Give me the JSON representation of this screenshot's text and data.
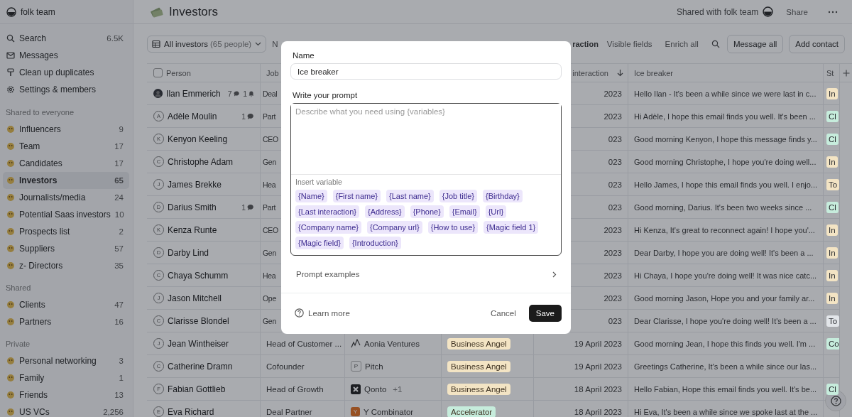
{
  "workspace": {
    "name": "folk team"
  },
  "nav": [
    {
      "label": "Search",
      "count": "6.5K"
    },
    {
      "label": "Messages"
    },
    {
      "label": "Clean up duplicates"
    },
    {
      "label": "Settings & members"
    }
  ],
  "sections": [
    {
      "title": "Shared to everyone",
      "items": [
        {
          "label": "Influencers",
          "count": "9",
          "selected": false
        },
        {
          "label": "Team",
          "count": "17",
          "selected": false
        },
        {
          "label": "Candidates",
          "count": "17",
          "selected": false
        },
        {
          "label": "Investors",
          "count": "65",
          "selected": true
        },
        {
          "label": "Journalists/media",
          "count": "24",
          "selected": false
        },
        {
          "label": "Potential Saas investors",
          "count": "10",
          "selected": false
        },
        {
          "label": "Prospects list",
          "count": "2",
          "selected": false
        },
        {
          "label": "Suppliers",
          "count": "57",
          "selected": false
        },
        {
          "label": "z- Directors",
          "count": "35",
          "selected": false
        }
      ]
    },
    {
      "title": "Shared",
      "items": [
        {
          "label": "Clients",
          "count": "47",
          "selected": false
        },
        {
          "label": "Partners",
          "count": "16",
          "selected": false
        }
      ]
    },
    {
      "title": "Private",
      "items": [
        {
          "label": "Personal networking",
          "count": "3",
          "selected": false
        },
        {
          "label": "Family",
          "count": "1",
          "selected": false
        },
        {
          "label": "Friends",
          "count": "13",
          "selected": false
        },
        {
          "label": "US VCs",
          "count": "2,256",
          "selected": false
        }
      ]
    }
  ],
  "page": {
    "title": "Investors",
    "shared_with": "Shared with folk team",
    "share": "Share"
  },
  "toolbar": {
    "view": "All investors",
    "view_count": "(65 people)",
    "cut_button": "N",
    "sort": "raction",
    "actions": [
      "Visible fields",
      "Enrich all"
    ],
    "buttons": [
      "Message all",
      "Add contact"
    ]
  },
  "table": {
    "header": {
      "checked": false,
      "person": "Person",
      "job": "Job",
      "date": "interaction",
      "ice_breaker": "Ice breaker",
      "status": "St"
    },
    "rows": [
      {
        "name": "Ilan Emmerich",
        "comments": "7",
        "reminders": "1",
        "job": "Deal",
        "date": "2023",
        "ice_breaker": "Hello Ilan - It's been a while since we were last in c...",
        "status": {
          "label": "In",
          "color": "#f3e4c4"
        }
      },
      {
        "name": "Adèle Moulin",
        "initial": "A",
        "comments": "1",
        "job": "Part",
        "date": "2023",
        "ice_breaker": "Hi Adèle, I hope this email finds you well. It's been ...",
        "status": {
          "label": "Cl",
          "color": "#c6ecdc"
        }
      },
      {
        "name": "Kenyon Keeling",
        "initial": "K",
        "job": "CEO",
        "date": "023",
        "ice_breaker": "Good morning Kenyon, I hope this message finds y...",
        "status": {
          "label": "Cl",
          "color": "#c6ecdc"
        }
      },
      {
        "name": "Christophe Adam",
        "initial": "C",
        "job": "Gen",
        "date": "023",
        "ice_breaker": "Good morning Christophe, I hope you're doing well...",
        "status": {
          "label": "In",
          "color": "#f3e4c4"
        }
      },
      {
        "name": "James Brekke",
        "initial": "J",
        "job": "Hea",
        "date": "023",
        "ice_breaker": "Hello James, I hope this email finds you well. I enjo...",
        "status": {
          "label": "To",
          "color": "#f3e4c4"
        }
      },
      {
        "name": "Darius Smith",
        "initial": "D",
        "comments": "1",
        "job": "Part",
        "date": "023",
        "ice_breaker": "Good morning, Darius. It's been two weeks since ...",
        "status": {
          "label": "Cl",
          "color": "#c6ecdc"
        }
      },
      {
        "name": "Kenza Runte",
        "initial": "K",
        "job": "CEO",
        "date": "2023",
        "ice_breaker": "Hi Kenza, It's great to reconnect again! I hope you'...",
        "status": {
          "label": "In",
          "color": "#f3e4c4"
        }
      },
      {
        "name": "Darby Lind",
        "initial": "D",
        "job": "Gen",
        "date": "2023",
        "ice_breaker": "Dear Darby, I hope you are doing well! It's been a ...",
        "status": {
          "label": "In",
          "color": "#f3e4c4"
        }
      },
      {
        "name": "Chaya Schumm",
        "initial": "C",
        "job": "Hea",
        "date": "2023",
        "ice_breaker": "Hi Chaya, I hope you're doing well! It was nice catc...",
        "status": {
          "label": "In",
          "color": "#f3e4c4"
        }
      },
      {
        "name": "Jason Mitchell",
        "initial": "J",
        "job": "Ope",
        "date": "2023",
        "ice_breaker": "Good morning Jason, Hope you and your family ar...",
        "status": {
          "label": "In",
          "color": "#f3e4c4"
        }
      },
      {
        "name": "Clarisse Blondel",
        "initial": "C",
        "job": "Gen",
        "date": "023",
        "ice_breaker": "Dear Clarisse, I hope you're doing well! It's been a ...",
        "status": {
          "label": "To",
          "color": "#e2e5e9"
        }
      },
      {
        "name": "Jean Wintheiser",
        "initial": "J",
        "job": "Head of Customer ...",
        "company": {
          "name": "Aonia Ventures",
          "kind": "line"
        },
        "type": {
          "label": "Business Angel",
          "color": "#f3e4c4"
        },
        "date": "19 April 2023",
        "ice_breaker": "Good morning Jean, I hope this finds you well. I'm ...",
        "status": {
          "label": "Co",
          "color": "#c6ecdc"
        }
      },
      {
        "name": "Catherine Dramn",
        "initial": "C",
        "job": "Cofounder",
        "company": {
          "name": "Pitch",
          "kind": "letter",
          "letter": "P"
        },
        "type": {
          "label": "Business Angel",
          "color": "#f3e4c4"
        },
        "date": "19 April 2023",
        "ice_breaker": "Greetings Catherine, It's been a while since our las..."
      },
      {
        "name": "Fabian Gottlieb",
        "initial": "F",
        "job": "Head of Growth",
        "company": {
          "name": "Qonto",
          "kind": "dark",
          "extra": "+1"
        },
        "type": {
          "label": "Business Angel",
          "color": "#f3e4c4"
        },
        "date": "18 April 2023",
        "ice_breaker": "Hello Fabian, Hope this email finds you well. It's be...",
        "status": {
          "label": "Cl",
          "color": "#c6ecdc"
        }
      },
      {
        "name": "Eva Richard",
        "initial": "E",
        "job": "Deal Partner",
        "company": {
          "name": "Y Combinator",
          "kind": "orange",
          "letter": "Y"
        },
        "type": {
          "label": "Accelerator",
          "color": "#c6ecdc"
        },
        "date": "18 April 2023",
        "ice_breaker": "Hi Eva, It's been a while since we spoke last at the ..."
      }
    ]
  },
  "dialog": {
    "name_label": "Name",
    "name_value": "Ice breaker",
    "prompt_label": "Write your prompt",
    "prompt_placeholder": "Describe what you need using {variables}",
    "insert_label": "Insert variable",
    "variables": [
      "{Name}",
      "{First name}",
      "{Last name}",
      "{Job title}",
      "{Birthday}",
      "{Last interaction}",
      "{Address}",
      "{Phone}",
      "{Email}",
      "{Url}",
      "{Company name}",
      "{Company url}",
      "{How to use}",
      "{Magic field 1}",
      "{Magic field}",
      "{Introduction}"
    ],
    "examples": "Prompt examples",
    "learn_more": "Learn more",
    "cancel": "Cancel",
    "save": "Save"
  }
}
